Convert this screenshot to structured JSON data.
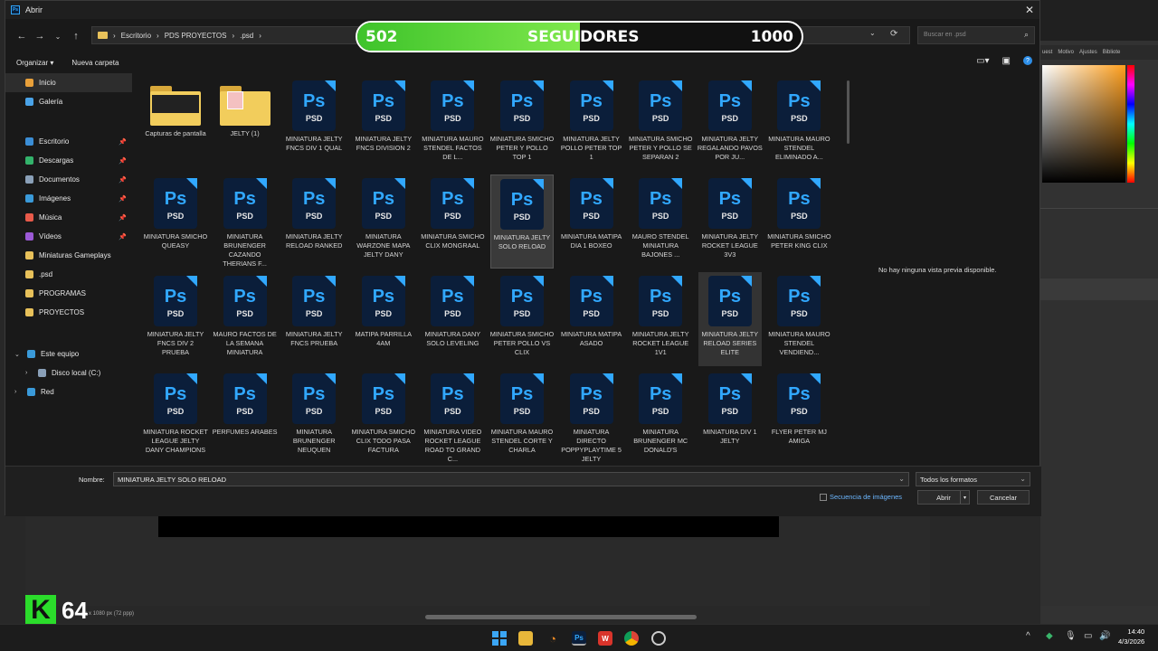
{
  "dialog": {
    "title": "Abrir",
    "breadcrumb": [
      "Escritorio",
      "PDS PROYECTOS",
      ".psd"
    ],
    "search_placeholder": "Buscar en .psd",
    "toolbar": {
      "organize": "Organizar",
      "new_folder": "Nueva carpeta"
    },
    "preview_text": "No hay ninguna vista previa disponible.",
    "name_label": "Nombre:",
    "name_value": "MINIATURA JELTY SOLO RELOAD",
    "format": "Todos los formatos",
    "sequence": "Secuencia de imágenes",
    "open": "Abrir",
    "cancel": "Cancelar"
  },
  "sidebar": {
    "items": [
      {
        "label": "Inicio",
        "icon": "home-icon",
        "color": "#e8a03a",
        "selected": true
      },
      {
        "label": "Galería",
        "icon": "gallery-icon",
        "color": "#4aa3e8"
      },
      {
        "label": "Escritorio",
        "icon": "desktop-icon",
        "color": "#3b8ed6",
        "pinned": true
      },
      {
        "label": "Descargas",
        "icon": "download-icon",
        "color": "#33b36b",
        "pinned": true
      },
      {
        "label": "Documentos",
        "icon": "documents-icon",
        "color": "#8aa0b8",
        "pinned": true
      },
      {
        "label": "Imágenes",
        "icon": "images-icon",
        "color": "#3a9ad9",
        "pinned": true
      },
      {
        "label": "Música",
        "icon": "music-icon",
        "color": "#e85a4a",
        "pinned": true
      },
      {
        "label": "Vídeos",
        "icon": "videos-icon",
        "color": "#9b59d6",
        "pinned": true
      },
      {
        "label": "Miniaturas Gameplays",
        "icon": "folder-icon",
        "color": "#e8c15a"
      },
      {
        "label": ".psd",
        "icon": "folder-icon",
        "color": "#e8c15a"
      },
      {
        "label": "PROGRAMAS",
        "icon": "folder-icon",
        "color": "#e8c15a"
      },
      {
        "label": "PROYECTOS",
        "icon": "folder-icon",
        "color": "#e8c15a"
      }
    ],
    "tree": [
      {
        "label": "Este equipo",
        "icon": "computer-icon",
        "color": "#3a9ad9",
        "expanded": true
      },
      {
        "label": "Disco local (C:)",
        "icon": "drive-icon",
        "color": "#8aa0b8"
      },
      {
        "label": "Red",
        "icon": "network-icon",
        "color": "#3a9ad9"
      }
    ]
  },
  "files": [
    {
      "name": "Capturas de pantalla",
      "type": "folder-dark"
    },
    {
      "name": "JELTY (1)",
      "type": "folder-photo"
    },
    {
      "name": "MINIATURA JELTY FNCS DIV 1 QUAL",
      "type": "psd"
    },
    {
      "name": "MINIATURA JELTY FNCS DIVISION 2",
      "type": "psd"
    },
    {
      "name": "MINIATURA MAURO STENDEL FACTOS DE L...",
      "type": "psd"
    },
    {
      "name": "MINIATURA SMICHO PETER Y POLLO TOP 1",
      "type": "psd"
    },
    {
      "name": "MINIATURA JELTY POLLO PETER TOP 1",
      "type": "psd"
    },
    {
      "name": "MINIATURA SMICHO PETER Y POLLO SE SEPARAN 2",
      "type": "psd"
    },
    {
      "name": "MINIATURA JELTY REGALANDO PAVOS POR JU...",
      "type": "psd"
    },
    {
      "name": "MINIATURA MAURO STENDEL ELIMINADO A...",
      "type": "psd"
    },
    {
      "name": "MINIATURA SMICHO QUEASY",
      "type": "psd"
    },
    {
      "name": "MINIATURA BRUNENGER CAZANDO THERIANS F...",
      "type": "psd"
    },
    {
      "name": "MINIATURA JELTY RELOAD RANKED",
      "type": "psd"
    },
    {
      "name": "MINIATURA WARZONE MAPA JELTY DANY",
      "type": "psd"
    },
    {
      "name": "MINIATURA SMICHO CLIX MONGRAAL",
      "type": "psd"
    },
    {
      "name": "MINIATURA JELTY SOLO RELOAD",
      "type": "psd",
      "selected": true
    },
    {
      "name": "MINIATURA MATIPA DIA 1 BOXEO",
      "type": "psd"
    },
    {
      "name": "MAURO STENDEL MINIATURA BAJONES ...",
      "type": "psd"
    },
    {
      "name": "MINIATURA JELTY ROCKET LEAGUE 3V3",
      "type": "psd"
    },
    {
      "name": "MINIATURA SMICHO PETER KING CLIX",
      "type": "psd"
    },
    {
      "name": "MINIATURA JELTY FNCS DIV 2 PRUEBA",
      "type": "psd"
    },
    {
      "name": "MAURO FACTOS DE LA SEMANA MINIATURA",
      "type": "psd"
    },
    {
      "name": "MINIATURA JELTY FNCS PRUEBA",
      "type": "psd"
    },
    {
      "name": "MATIPA PARRILLA 4AM",
      "type": "psd"
    },
    {
      "name": "MINIATURA DANY SOLO LEVELING",
      "type": "psd"
    },
    {
      "name": "MINIATURA SMICHO PETER POLLO VS CLIX",
      "type": "psd"
    },
    {
      "name": "MINIATURA MATIPA ASADO",
      "type": "psd"
    },
    {
      "name": "MINIATURA JELTY ROCKET LEAGUE 1V1",
      "type": "psd"
    },
    {
      "name": "MINIATURA JELTY RELOAD SERIES ELITE",
      "type": "psd",
      "hover": true
    },
    {
      "name": "MINIATURA MAURO STENDEL VENDIEND...",
      "type": "psd"
    },
    {
      "name": "MINIATURA ROCKET LEAGUE JELTY DANY CHAMPIONS",
      "type": "psd"
    },
    {
      "name": "PERFUMES ARABES",
      "type": "psd"
    },
    {
      "name": "MINIATURA BRUNENGER NEUQUEN",
      "type": "psd"
    },
    {
      "name": "MINIATURA SMICHO CLIX TODO PASA FACTURA",
      "type": "psd"
    },
    {
      "name": "MINIATURA VIDEO ROCKET LEAGUE ROAD TO GRAND C...",
      "type": "psd"
    },
    {
      "name": "MINIATURA MAURO STENDEL CORTE Y CHARLA",
      "type": "psd"
    },
    {
      "name": "MINIATURA DIRECTO POPPYPLAYTIME 5 JELTY",
      "type": "psd"
    },
    {
      "name": "MINIATURA BRUNENGER MC DONALD'S",
      "type": "psd"
    },
    {
      "name": "MINIATURA DIV 1 JELTY",
      "type": "psd"
    },
    {
      "name": "FLYER PETER MJ AMIGA",
      "type": "psd"
    }
  ],
  "psd_icon": {
    "ps": "Ps",
    "psd": "PSD"
  },
  "followers": {
    "current": "502",
    "label": "SEGUIDORES",
    "goal": "1000",
    "progress": 0.5
  },
  "photoshop": {
    "tabs": [
      "uest",
      "Motivo",
      "Ajustes",
      "Bibliote"
    ],
    "status": "px x 1080 px (72 ppp)"
  },
  "overlay_badge": {
    "letter": "K",
    "number": "64"
  },
  "taskbar": {
    "time": "14:40",
    "date": "4/3/2026"
  }
}
